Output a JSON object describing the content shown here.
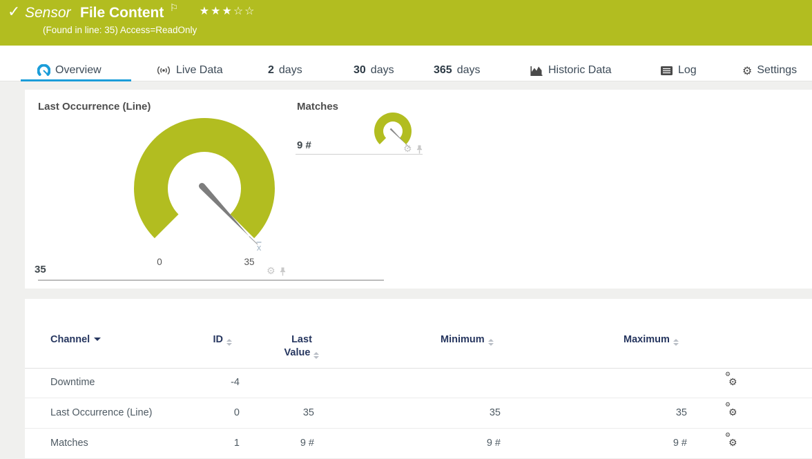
{
  "colors": {
    "brand_green": "#b2bd20",
    "accent_blue": "#1b9dd9",
    "header_navy": "#26365f"
  },
  "titlebar": {
    "sensor_kind": "Sensor",
    "sensor_name": "File Content",
    "subtitle": "(Found in line: 35) Access=ReadOnly",
    "stars_filled": "★★★",
    "stars_empty": "☆☆"
  },
  "tabs": {
    "overview": {
      "label": "Overview"
    },
    "live_data": {
      "label": "Live Data"
    },
    "d2": {
      "num": "2",
      "label": "days"
    },
    "d30": {
      "num": "30",
      "label": "days"
    },
    "d365": {
      "num": "365",
      "label": "days"
    },
    "historic": {
      "label": "Historic Data"
    },
    "log": {
      "label": "Log"
    },
    "settings": {
      "label": "Settings"
    }
  },
  "gauges": {
    "primary": {
      "title": "Last Occurrence (Line)",
      "value": "35",
      "scale_min": "0",
      "scale_max": "35",
      "avg_marker": "x̄"
    },
    "secondary": {
      "title": "Matches",
      "value": "9 #"
    }
  },
  "channel_table": {
    "headers": {
      "channel": "Channel",
      "id": "ID",
      "last_value_line1": "Last",
      "last_value_line2": "Value",
      "minimum": "Minimum",
      "maximum": "Maximum"
    },
    "rows": [
      {
        "channel": "Downtime",
        "id": "-4",
        "last": "",
        "min": "",
        "max": ""
      },
      {
        "channel": "Last Occurrence (Line)",
        "id": "0",
        "last": "35",
        "min": "35",
        "max": "35"
      },
      {
        "channel": "Matches",
        "id": "1",
        "last": "9 #",
        "min": "9 #",
        "max": "9 #"
      }
    ]
  }
}
